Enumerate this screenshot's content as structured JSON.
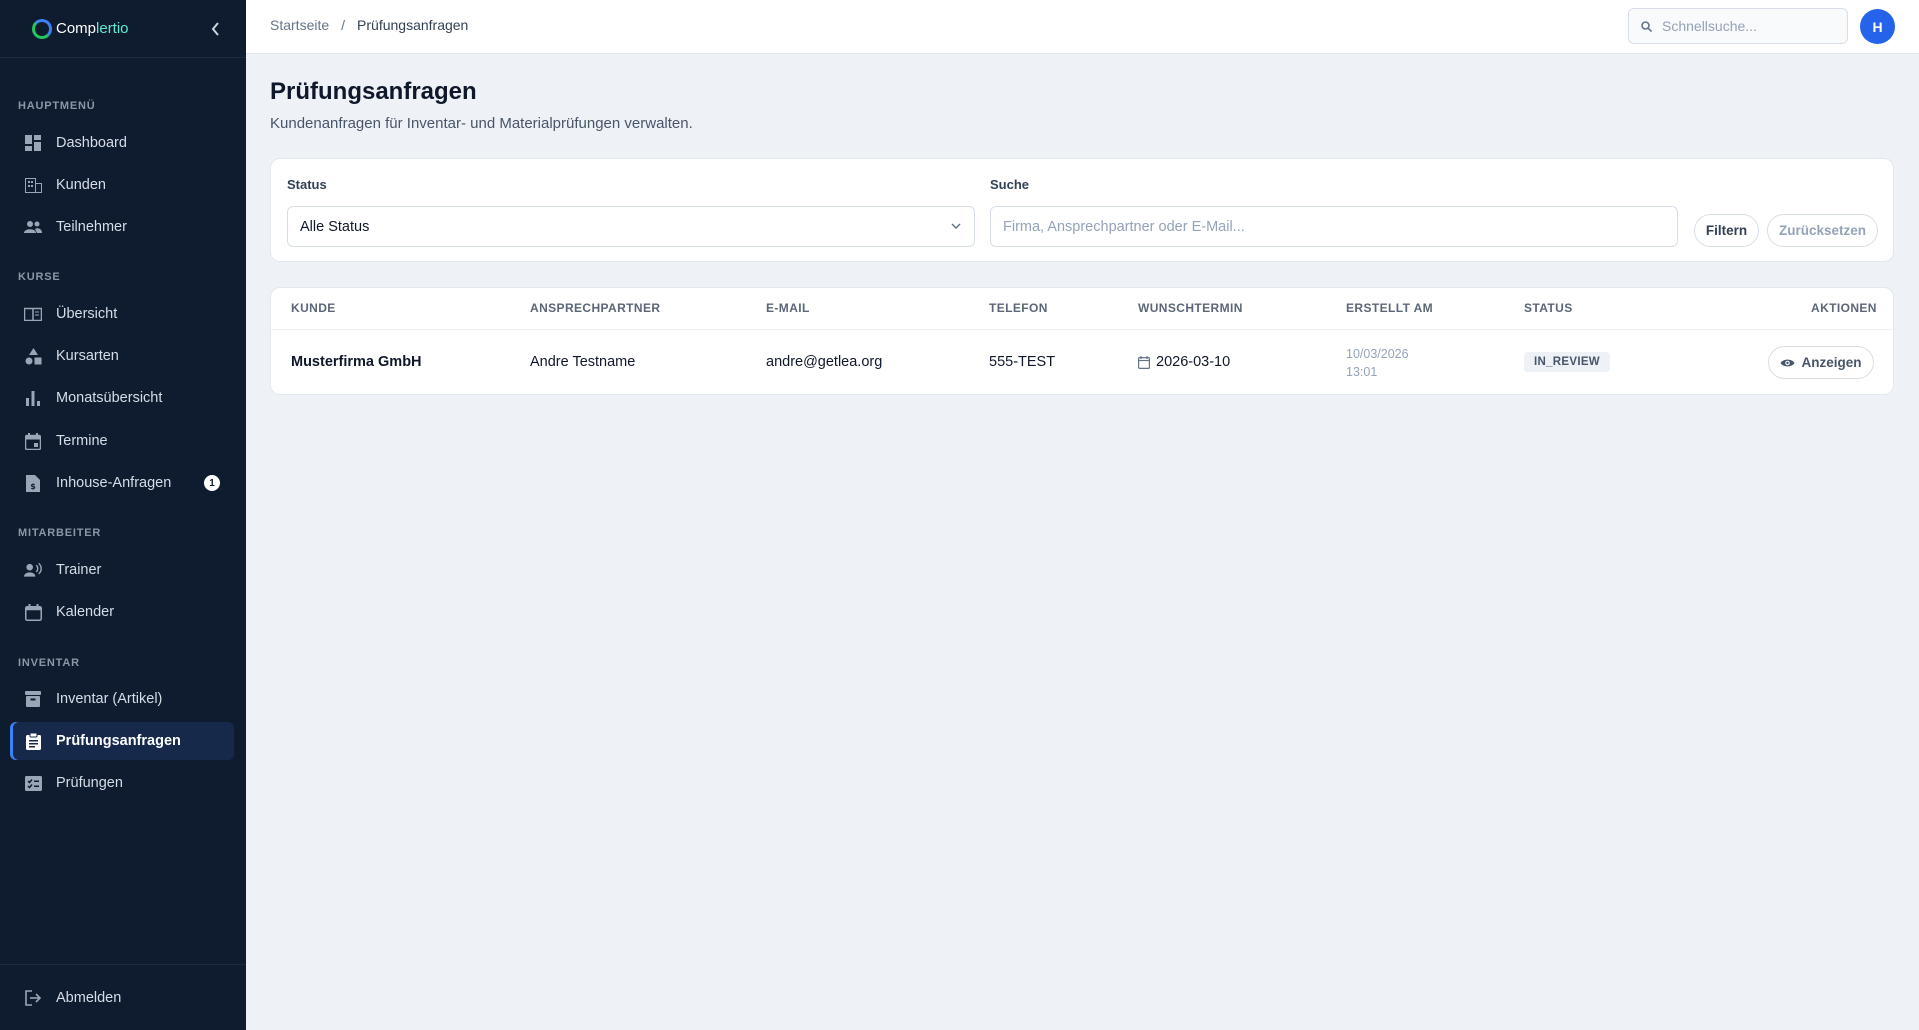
{
  "app": {
    "brand_prefix": "Comp",
    "brand_suffix": "lertio"
  },
  "sidebar": {
    "sections": {
      "main": "HAUPTMENÜ",
      "courses": "KURSE",
      "staff": "MITARBEITER",
      "inventory": "INVENTAR"
    },
    "items": [
      {
        "label": "Dashboard",
        "icon": "dashboard-icon"
      },
      {
        "label": "Kunden",
        "icon": "building-icon"
      },
      {
        "label": "Teilnehmer",
        "icon": "users-icon"
      },
      {
        "label": "Übersicht",
        "icon": "book-icon"
      },
      {
        "label": "Kursarten",
        "icon": "shapes-icon"
      },
      {
        "label": "Monatsübersicht",
        "icon": "bar-chart-icon"
      },
      {
        "label": "Termine",
        "icon": "calendar-icon"
      },
      {
        "label": "Inhouse-Anfragen",
        "icon": "document-icon",
        "badge": "1"
      },
      {
        "label": "Trainer",
        "icon": "trainer-icon"
      },
      {
        "label": "Kalender",
        "icon": "calendar-icon"
      },
      {
        "label": "Inventar (Artikel)",
        "icon": "archive-icon"
      },
      {
        "label": "Prüfungsanfragen",
        "icon": "clipboard-icon",
        "active": true
      },
      {
        "label": "Prüfungen",
        "icon": "checklist-icon"
      }
    ],
    "logout": "Abmelden"
  },
  "topbar": {
    "breadcrumb_home": "Startseite",
    "breadcrumb_separator": "/",
    "breadcrumb_current": "Prüfungsanfragen",
    "search_placeholder": "Schnellsuche...",
    "avatar_initial": "H"
  },
  "page": {
    "title": "Prüfungsanfragen",
    "subtitle": "Kundenanfragen für Inventar- und Materialprüfungen verwalten."
  },
  "filters": {
    "status_label": "Status",
    "status_value": "Alle Status",
    "search_label": "Suche",
    "search_placeholder": "Firma, Ansprechpartner oder E-Mail...",
    "filter_button": "Filtern",
    "reset_button": "Zurücksetzen"
  },
  "table": {
    "headers": {
      "customer": "KUNDE",
      "contact": "ANSPRECHPARTNER",
      "email": "E-MAIL",
      "phone": "TELEFON",
      "preferred_date": "WUNSCHTERMIN",
      "created": "ERSTELLT AM",
      "status": "STATUS",
      "actions": "AKTIONEN"
    },
    "rows": [
      {
        "customer": "Musterfirma GmbH",
        "contact": "Andre Testname",
        "email": "andre@getlea.org",
        "phone": "555-TEST",
        "preferred_date": "2026-03-10",
        "created_date": "10/03/2026",
        "created_time": "13:01",
        "status": "IN_REVIEW",
        "action": "Anzeigen"
      }
    ]
  },
  "colors": {
    "sidebar_bg": "#0f1b2e",
    "accent": "#2563eb",
    "page_bg": "#eef2f7"
  }
}
